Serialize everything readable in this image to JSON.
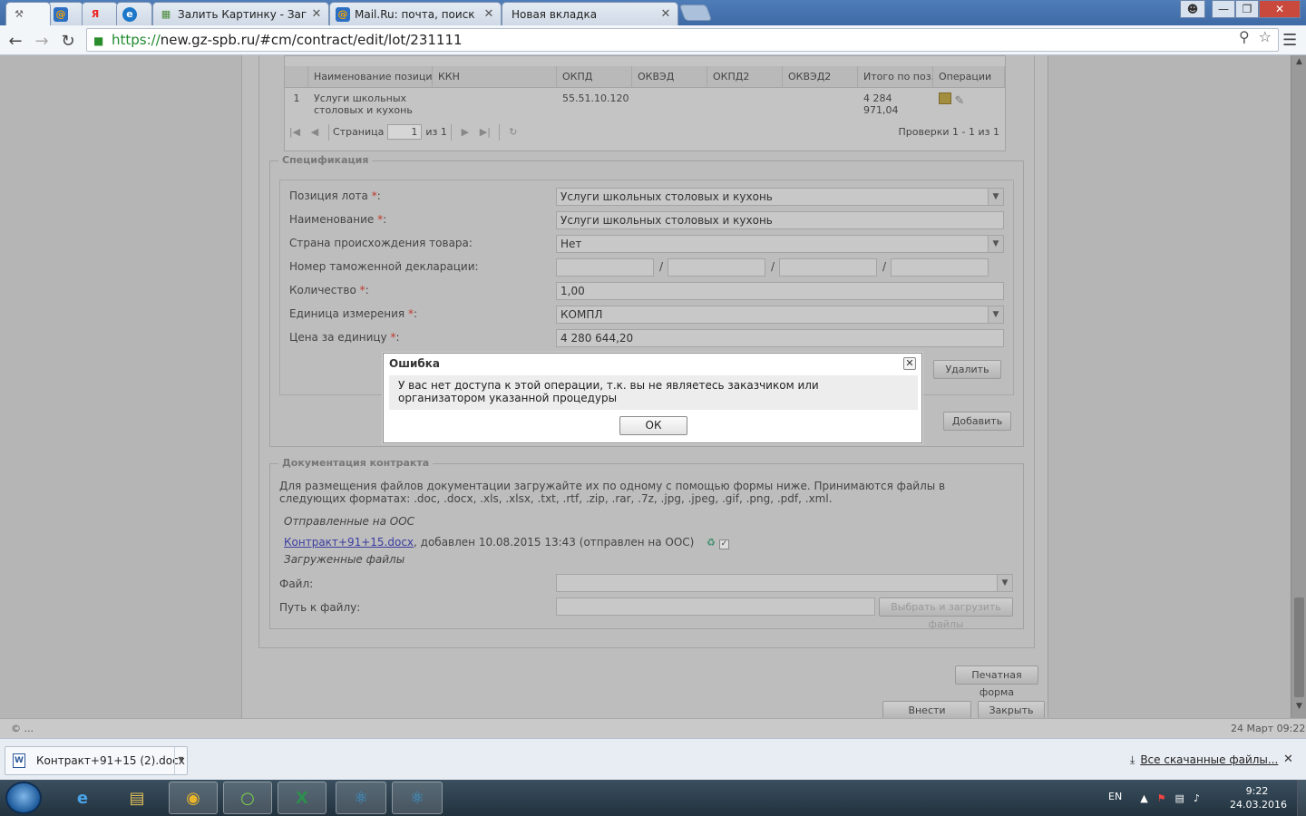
{
  "browser": {
    "tabs": [
      {
        "label": "",
        "icon": "wrench-icon",
        "active": true
      },
      {
        "label": "",
        "icon": "mail-ru-icon"
      },
      {
        "label": "",
        "icon": "yandex-icon"
      },
      {
        "label": "",
        "icon": "globe-icon"
      },
      {
        "label": "Залить Картинку - Загруз",
        "icon": "image-upload-icon"
      },
      {
        "label": "Mail.Ru: почта, поиск в и",
        "icon": "mail-ru-icon"
      },
      {
        "label": "Новая вкладка",
        "icon": ""
      }
    ],
    "url_scheme": "https://",
    "url_rest": "new.gz-spb.ru/#cm/contract/edit/lot/231111"
  },
  "grid": {
    "columns": [
      "Наименование позиции",
      "ККН",
      "ОКПД",
      "ОКВЭД",
      "ОКПД2",
      "ОКВЭД2",
      "Итого по поз...",
      "Операции"
    ],
    "rows": [
      {
        "num": "1",
        "name": "Услуги школьных столовых и кухонь",
        "kkn": "",
        "okpd": "55.51.10.120",
        "okved": "",
        "okpd2": "",
        "okved2": "",
        "total": "4 284 971,04"
      }
    ],
    "pager": {
      "page_label": "Страница",
      "page": "1",
      "of_label": "из 1",
      "summary": "Проверки 1 - 1 из 1"
    }
  },
  "spec": {
    "legend": "Спецификация",
    "lot_position_label": "Позиция лота",
    "lot_position_value": "Услуги школьных столовых и кухонь",
    "name_label": "Наименование",
    "name_value": "Услуги школьных столовых и кухонь",
    "country_label": "Страна происхождения товара:",
    "country_value": "Нет",
    "customs_label": "Номер таможенной декларации:",
    "customs_sep": "/",
    "quantity_label": "Количество",
    "quantity_value": "1,00",
    "unit_label": "Единица измерения",
    "unit_value": "КОМПЛ",
    "price_label": "Цена за единицу",
    "price_value": "4 280 644,20",
    "required_mark": "*",
    "colon": ":",
    "delete_label": "Удалить",
    "add_label": "Добавить"
  },
  "docs": {
    "legend": "Документация контракта",
    "hint": "Для размещения файлов документации загружайте их по одному с помощью формы ниже. Принимаются файлы в следующих форматах: .doc, .docx, .xls, .xlsx, .txt, .rtf, .zip, .rar, .7z, .jpg, .jpeg, .gif, .png, .pdf, .xml.",
    "sent_heading": "Отправленные на ООС",
    "file_link": "Контракт+91+15.docx",
    "file_meta": ", добавлен 10.08.2015 13:43 (отправлен на ООС)",
    "uploaded_heading": "Загруженные файлы",
    "file_label": "Файл:",
    "path_label": "Путь к файлу:",
    "choose_label": "Выбрать и загрузить файлы"
  },
  "footer_buttons": {
    "print_label": "Печатная форма",
    "apply_label": "Внести изменения",
    "close_label": "Закрыть"
  },
  "modal": {
    "title": "Ошибка",
    "message": "У вас нет доступа к этой операции, т.к. вы не являетесь заказчиком или организатором указанной процедуры",
    "ok_label": "ОК"
  },
  "statusbar": {
    "left": "© ...",
    "right": "24 Март 09:22"
  },
  "downloads": {
    "file_name": "Контракт+91+15 (2).docx",
    "all_label": "Все скачанные файлы..."
  },
  "taskbar": {
    "lang": "EN",
    "time": "9:22",
    "date": "24.03.2016"
  }
}
